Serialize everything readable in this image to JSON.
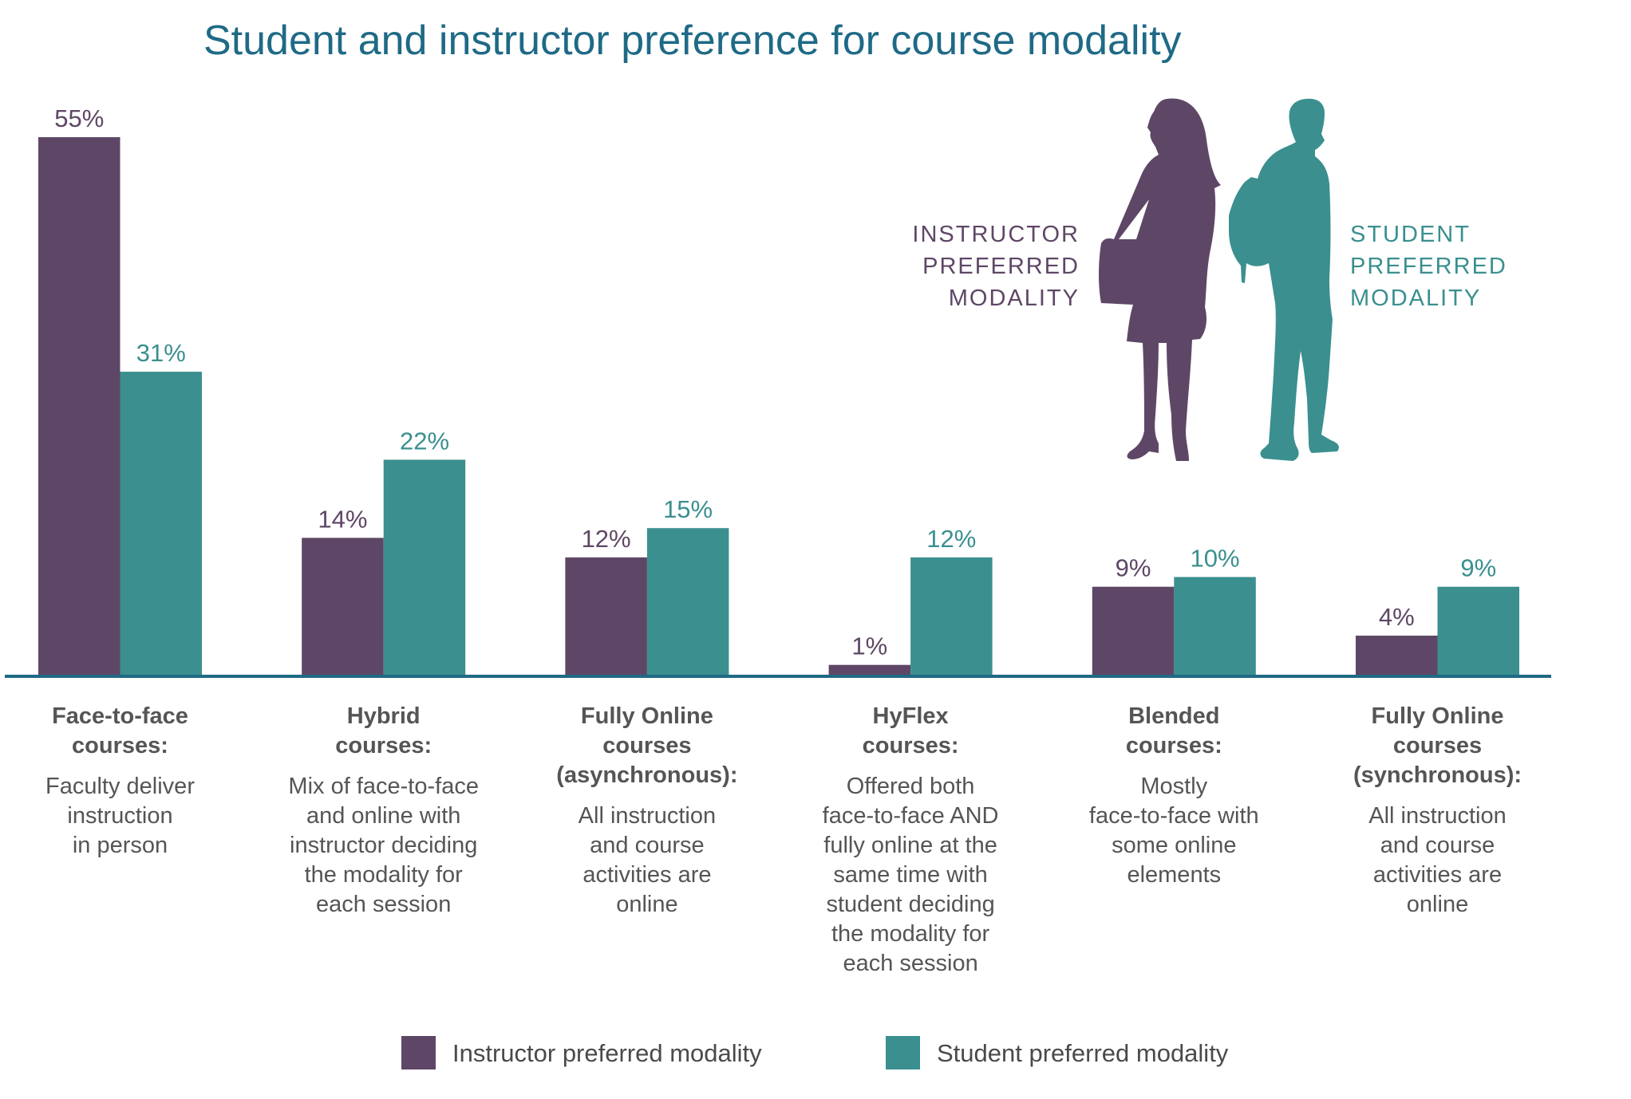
{
  "colors": {
    "instructor": "#5e4766",
    "student": "#3b8f8f",
    "title": "#1f6a86",
    "axis": "#1f6a86",
    "text": "#555555"
  },
  "chart_data": {
    "type": "bar",
    "title": "Student and instructor preference for course modality",
    "xlabel": "",
    "ylabel": "",
    "ylim": [
      0,
      55
    ],
    "grid": false,
    "legend_position": "bottom-center",
    "value_format": "{v}%",
    "categories": [
      {
        "heading": [
          "Face-to-face",
          "courses:"
        ],
        "description": [
          "Faculty deliver",
          "instruction",
          "in person"
        ]
      },
      {
        "heading": [
          "Hybrid",
          "courses:"
        ],
        "description": [
          "Mix of face-to-face",
          "and online with",
          "instructor deciding",
          "the modality for",
          "each session"
        ]
      },
      {
        "heading": [
          "Fully Online",
          "courses",
          "(asynchronous):"
        ],
        "description": [
          "All instruction",
          "and course",
          "activities are",
          "online"
        ]
      },
      {
        "heading": [
          "HyFlex",
          "courses:"
        ],
        "description": [
          "Offered both",
          "face-to-face AND",
          "fully online at the",
          "same time with",
          "student deciding",
          "the modality for",
          "each session"
        ]
      },
      {
        "heading": [
          "Blended",
          "courses:"
        ],
        "description": [
          "Mostly",
          "face-to-face with",
          "some online",
          "elements"
        ]
      },
      {
        "heading": [
          "Fully Online",
          "courses",
          "(synchronous):"
        ],
        "description": [
          "All instruction",
          "and course",
          "activities are",
          "online"
        ]
      }
    ],
    "series": [
      {
        "name": "Instructor preferred modality",
        "color_key": "instructor",
        "values": [
          55,
          14,
          12,
          1,
          9,
          4
        ]
      },
      {
        "name": "Student preferred modality",
        "color_key": "student",
        "values": [
          31,
          22,
          15,
          12,
          10,
          9
        ]
      }
    ]
  },
  "personas": {
    "instructor": {
      "label": [
        "INSTRUCTOR",
        "PREFERRED",
        "MODALITY"
      ],
      "icon": "woman-silhouette-icon"
    },
    "student": {
      "label": [
        "STUDENT",
        "PREFERRED",
        "MODALITY"
      ],
      "icon": "student-silhouette-icon"
    }
  },
  "legend": [
    {
      "label": "Instructor preferred modality",
      "color_key": "instructor"
    },
    {
      "label": "Student preferred modality",
      "color_key": "student"
    }
  ]
}
